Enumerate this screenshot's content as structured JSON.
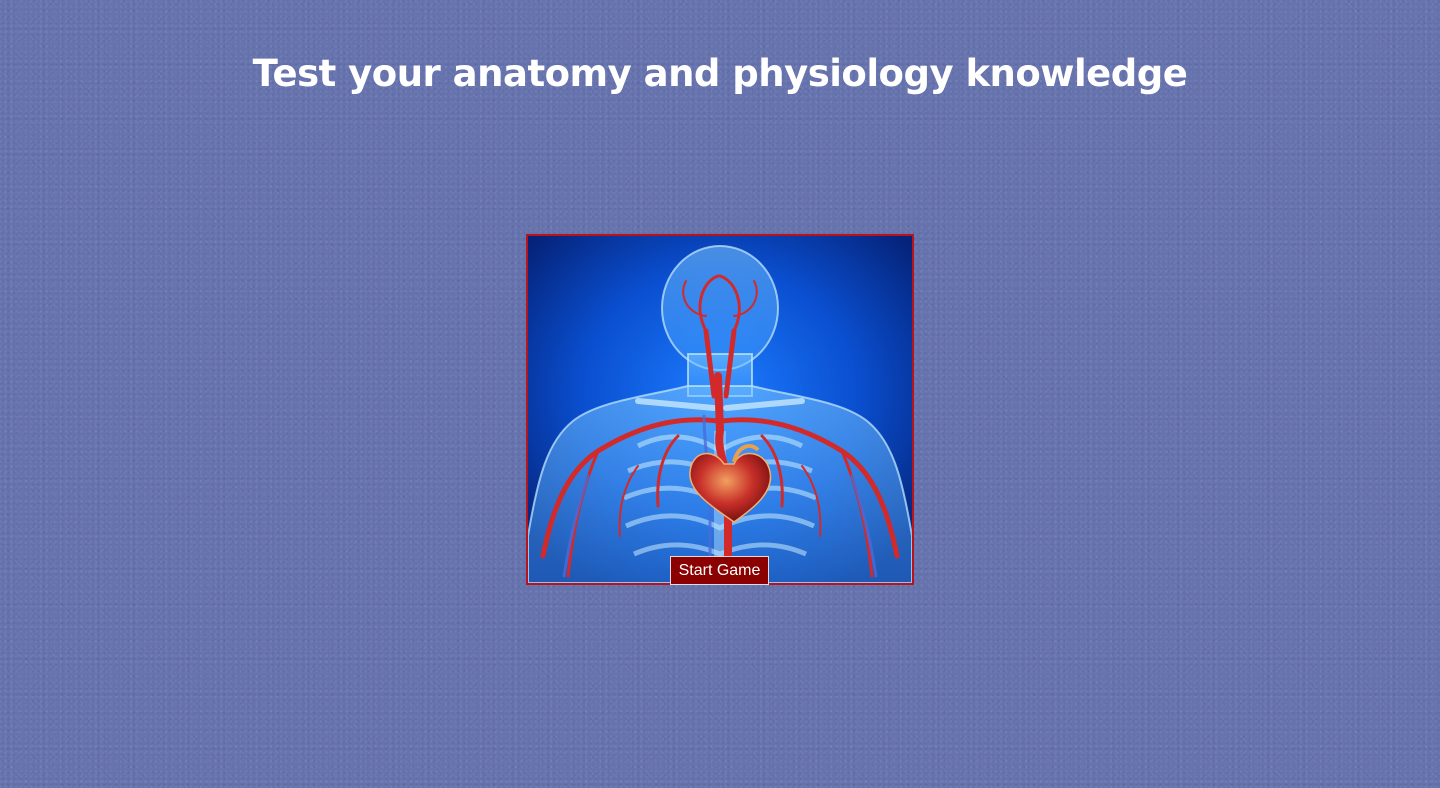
{
  "page": {
    "title": "Test your anatomy and physiology knowledge"
  },
  "game": {
    "illustration": "human-circulatory-system-illustration",
    "start_label": "Start Game"
  },
  "colors": {
    "background": "#6673ad",
    "title_text": "#ffffff",
    "frame_border": "#b8121a",
    "button_bg": "#8b0000",
    "button_text": "#ffffff"
  }
}
